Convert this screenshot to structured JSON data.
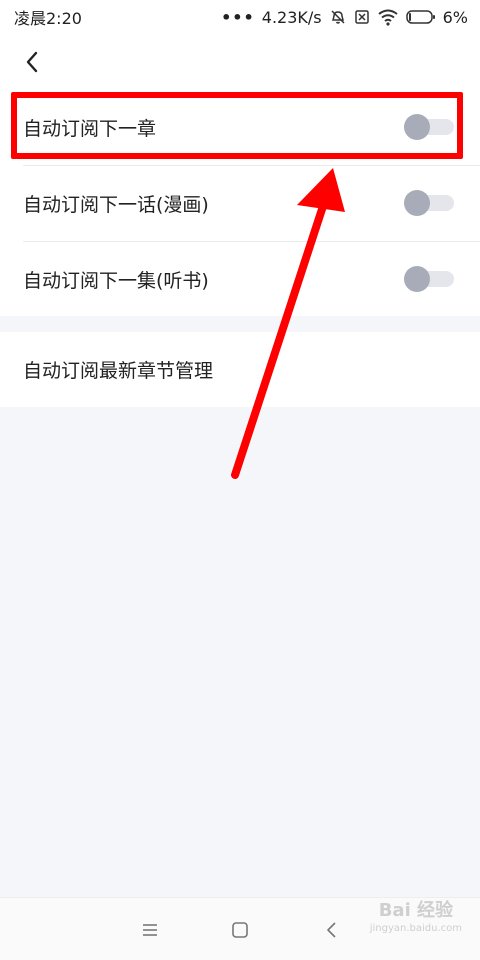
{
  "status_bar": {
    "time": "凌晨2:20",
    "dots": "•••",
    "network_speed": "4.23K/s",
    "battery": "6%",
    "icons": [
      "mute-icon",
      "sim-off-icon",
      "wifi-icon",
      "battery-icon"
    ]
  },
  "header": {
    "back_icon": "chevron-left-icon"
  },
  "settings": {
    "items": [
      {
        "label": "自动订阅下一章",
        "enabled": false
      },
      {
        "label": "自动订阅下一话(漫画)",
        "enabled": false
      },
      {
        "label": "自动订阅下一集(听书)",
        "enabled": false
      }
    ],
    "manage_label": "自动订阅最新章节管理"
  },
  "nav_bar": {
    "icons": [
      "menu-icon",
      "home-icon",
      "back-icon"
    ]
  },
  "watermark": {
    "main": "Bai 经验",
    "sub": "jingyan.baidu.com"
  },
  "colors": {
    "annotation": "#ff0000",
    "toggle_off_knob": "#a8acb8",
    "toggle_off_track": "#e4e6ec",
    "background": "#f5f6fa"
  }
}
